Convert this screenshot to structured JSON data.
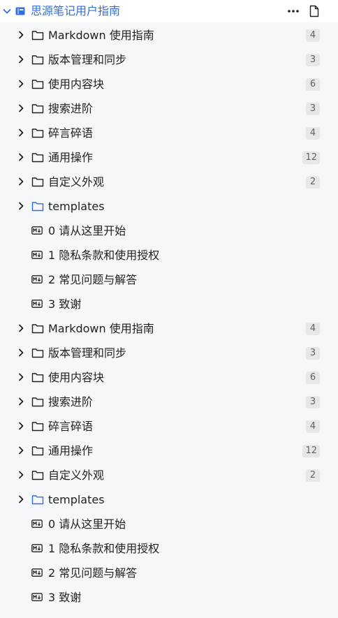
{
  "notebook": {
    "title": "思源笔记用户指南",
    "icon": "book-icon"
  },
  "header": {
    "more_icon": "more-icon",
    "new_doc_icon": "new-document-icon"
  },
  "items": [
    {
      "type": "folder",
      "label": "Markdown 使用指南",
      "count": "4"
    },
    {
      "type": "folder",
      "label": "版本管理和同步",
      "count": "3"
    },
    {
      "type": "folder",
      "label": "使用内容块",
      "count": "6"
    },
    {
      "type": "folder",
      "label": "搜索进阶",
      "count": "3"
    },
    {
      "type": "folder",
      "label": "碎言碎语",
      "count": "4"
    },
    {
      "type": "folder",
      "label": "通用操作",
      "count": "12"
    },
    {
      "type": "folder",
      "label": "自定义外观",
      "count": "2"
    },
    {
      "type": "folder-blue",
      "label": "templates",
      "count": ""
    },
    {
      "type": "doc",
      "label": "0 请从这里开始",
      "count": ""
    },
    {
      "type": "doc",
      "label": "1 隐私条款和使用授权",
      "count": ""
    },
    {
      "type": "doc",
      "label": "2 常见问题与解答",
      "count": ""
    },
    {
      "type": "doc",
      "label": "3 致谢",
      "count": ""
    },
    {
      "type": "folder",
      "label": "Markdown 使用指南",
      "count": "4"
    },
    {
      "type": "folder",
      "label": "版本管理和同步",
      "count": "3"
    },
    {
      "type": "folder",
      "label": "使用内容块",
      "count": "6"
    },
    {
      "type": "folder",
      "label": "搜索进阶",
      "count": "3"
    },
    {
      "type": "folder",
      "label": "碎言碎语",
      "count": "4"
    },
    {
      "type": "folder",
      "label": "通用操作",
      "count": "12"
    },
    {
      "type": "folder",
      "label": "自定义外观",
      "count": "2"
    },
    {
      "type": "folder-blue",
      "label": "templates",
      "count": ""
    },
    {
      "type": "doc",
      "label": "0 请从这里开始",
      "count": ""
    },
    {
      "type": "doc",
      "label": "1 隐私条款和使用授权",
      "count": ""
    },
    {
      "type": "doc",
      "label": "2 常见问题与解答",
      "count": ""
    },
    {
      "type": "doc",
      "label": "3 致谢",
      "count": ""
    }
  ],
  "colors": {
    "accent": "#2f6fdf",
    "badge_bg": "#e6e7ea",
    "panel_bg": "#f6f7f9"
  }
}
